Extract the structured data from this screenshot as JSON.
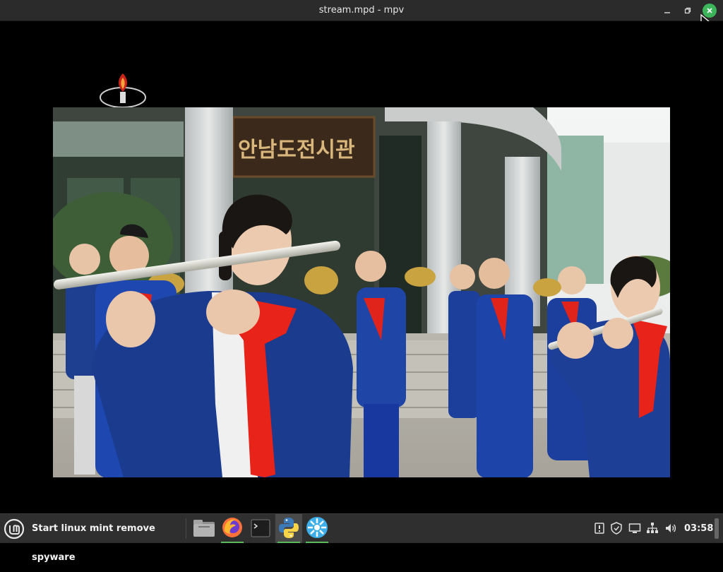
{
  "window": {
    "title": "stream.mpd - mpv"
  },
  "video": {
    "sign_text": "안남도전시관"
  },
  "taskbar": {
    "start_label": "Start linux mint remove spyware",
    "launchers": [
      "file-manager",
      "firefox",
      "terminal",
      "python",
      "app"
    ],
    "clock": "03:58"
  },
  "colors": {
    "titlebar": "#2b2b2b",
    "taskbar": "#2f2f2f",
    "close": "#3cb55a",
    "indicator": "#5bb85d"
  }
}
